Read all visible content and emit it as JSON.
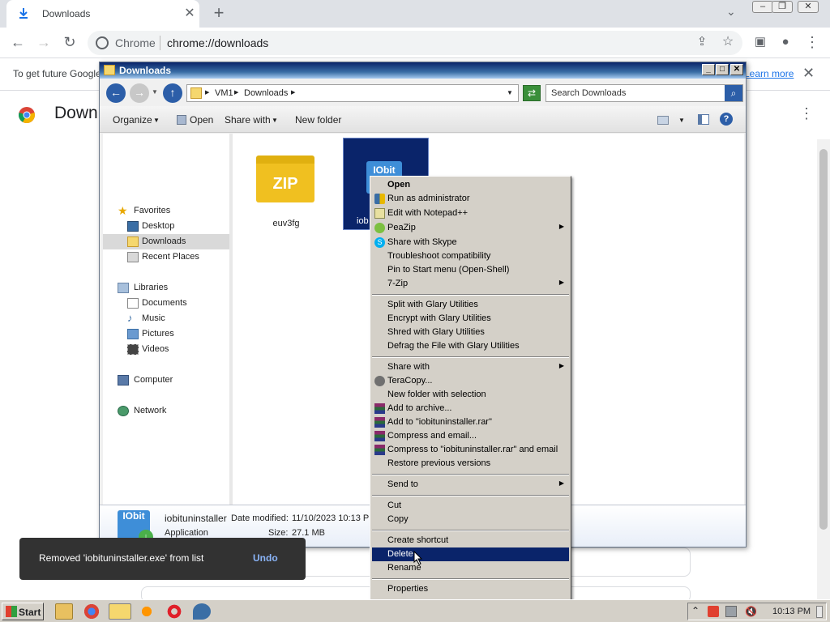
{
  "browser": {
    "tab_title": "Downloads",
    "site_label": "Chrome",
    "url": "chrome://downloads",
    "infobar_text": "To get future Google",
    "infobar_link": "Learn more",
    "page_title": "Downloads"
  },
  "explorer": {
    "window_title": "Downloads",
    "breadcrumb": [
      "VM1",
      "Downloads"
    ],
    "search_placeholder": "Search Downloads",
    "commands": {
      "organize": "Organize",
      "open": "Open",
      "share_with": "Share with",
      "new_folder": "New folder"
    },
    "nav": {
      "favorites": "Favorites",
      "desktop": "Desktop",
      "downloads": "Downloads",
      "recent": "Recent Places",
      "libraries": "Libraries",
      "documents": "Documents",
      "music": "Music",
      "pictures": "Pictures",
      "videos": "Videos",
      "computer": "Computer",
      "network": "Network"
    },
    "files": [
      {
        "name": "euv3fg",
        "icon_text": "ZIP"
      },
      {
        "name": "iob",
        "icon_text": "IObit"
      }
    ],
    "details": {
      "name": "iobituninstaller",
      "type": "Application",
      "date_label": "Date modified:",
      "date_value": "11/10/2023 10:13 P",
      "size_label": "Size:",
      "size_value": "27.1 MB",
      "icon_text": "IObit"
    }
  },
  "context_menu": {
    "items": [
      {
        "label": "Open",
        "bold": true
      },
      {
        "label": "Run as administrator",
        "icon": "shield-icon"
      },
      {
        "label": "Edit with Notepad++",
        "icon": "notepad-icon"
      },
      {
        "label": "PeaZip",
        "icon": "peazip-icon",
        "submenu": true
      },
      {
        "label": "Share with Skype",
        "icon": "skype-icon"
      },
      {
        "label": "Troubleshoot compatibility"
      },
      {
        "label": "Pin to Start menu (Open-Shell)"
      },
      {
        "label": "7-Zip",
        "submenu": true
      },
      {
        "label": "Split with Glary Utilities"
      },
      {
        "label": "Encrypt with Glary Utilities"
      },
      {
        "label": "Shred with Glary Utilities"
      },
      {
        "label": "Defrag the File with Glary Utilities"
      },
      {
        "label": "Share with",
        "submenu": true
      },
      {
        "label": "TeraCopy...",
        "icon": "teracopy-icon"
      },
      {
        "label": "New folder with selection"
      },
      {
        "label": "Add to archive...",
        "icon": "winrar-icon"
      },
      {
        "label": "Add to \"iobituninstaller.rar\"",
        "icon": "winrar-icon"
      },
      {
        "label": "Compress and email...",
        "icon": "winrar-icon"
      },
      {
        "label": "Compress to \"iobituninstaller.rar\" and email",
        "icon": "winrar-icon"
      },
      {
        "label": "Restore previous versions"
      },
      {
        "label": "Send to",
        "submenu": true
      },
      {
        "label": "Cut"
      },
      {
        "label": "Copy"
      },
      {
        "label": "Create shortcut"
      },
      {
        "label": "Delete",
        "highlighted": true
      },
      {
        "label": "Rename"
      },
      {
        "label": "Properties"
      }
    ]
  },
  "toast": {
    "message": "Removed 'iobituninstaller.exe' from list",
    "undo": "Undo"
  },
  "taskbar": {
    "start": "Start",
    "clock": "10:13 PM"
  },
  "colors": {
    "menu_highlight": "#0a246a",
    "menu_bg": "#d4d0c8",
    "link": "#1a73e8",
    "toast_bg": "#323232"
  }
}
